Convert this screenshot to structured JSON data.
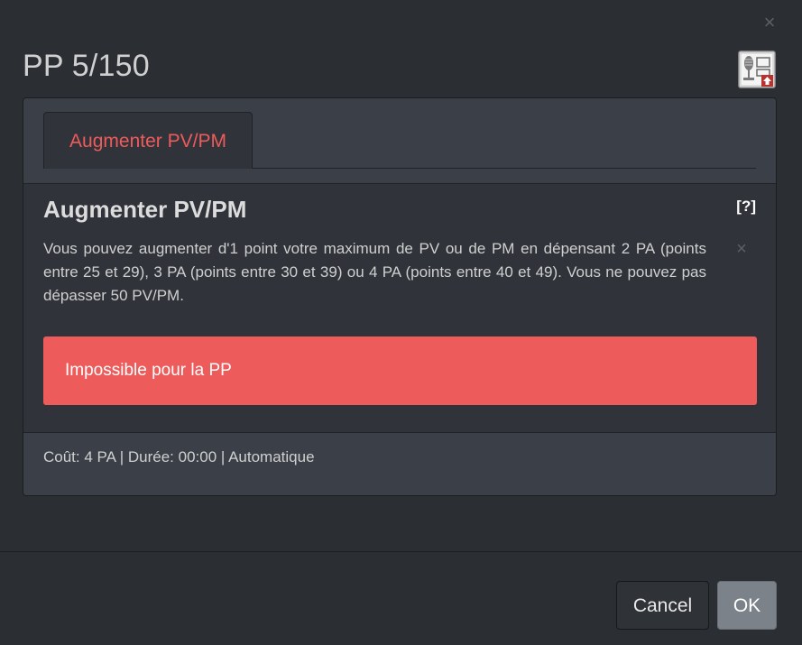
{
  "modal": {
    "title": "PP 5/150",
    "close_glyph": "×",
    "skill_icon": "microphone-upgrade-icon"
  },
  "tabs": [
    {
      "label": "Augmenter PV/PM",
      "active": true
    }
  ],
  "content": {
    "title": "Augmenter PV/PM",
    "help_label": "[?]",
    "description": "Vous pouvez augmenter d'1 point votre maximum de PV ou de PM en dépensant 2 PA (points entre 25 et 29), 3 PA (points entre 30 et 39) ou 4 PA (points entre 40 et 49). Vous ne pouvez pas dépasser 50 PV/PM.",
    "alert": "Impossible pour la PP",
    "footer": "Coût: 4 PA | Durée: 00:00 | Automatique"
  },
  "buttons": {
    "cancel": "Cancel",
    "ok": "OK"
  },
  "colors": {
    "accent": "#ee5b5b",
    "background": "#2b2e33",
    "panel": "#30343a"
  }
}
